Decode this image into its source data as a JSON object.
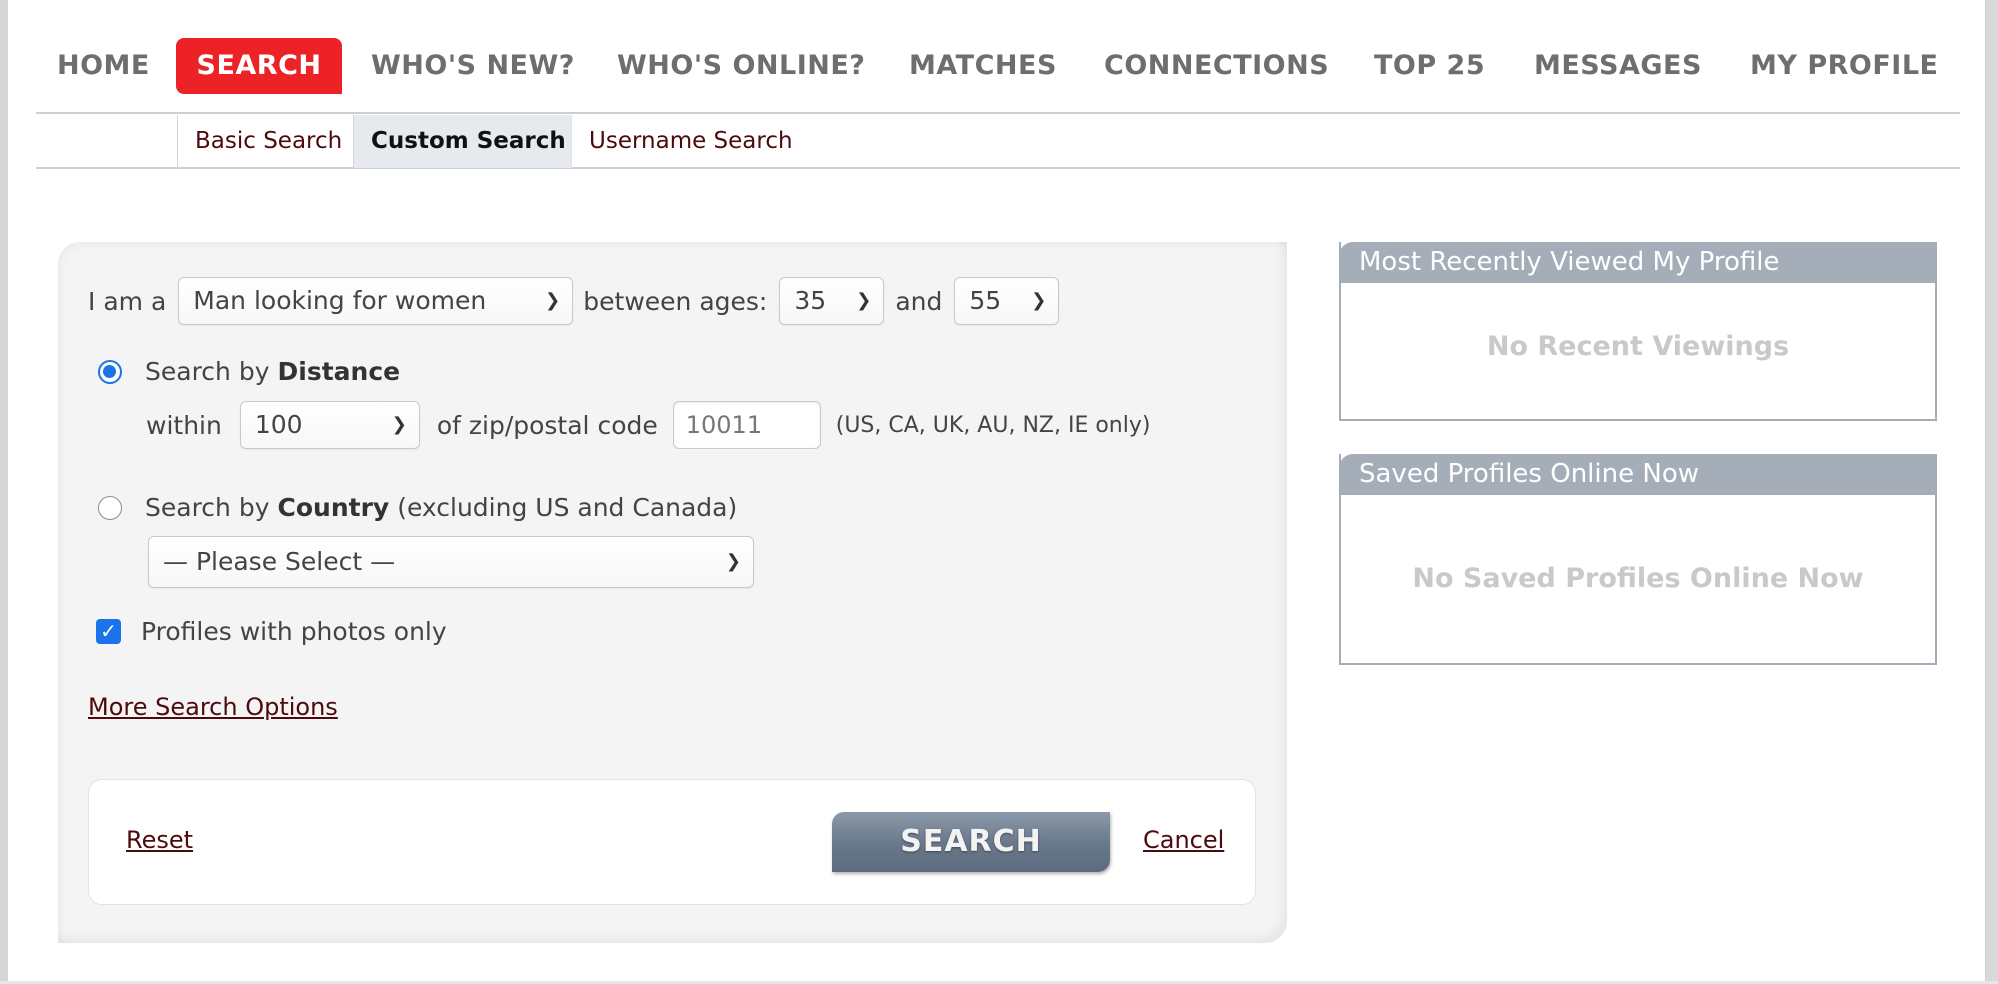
{
  "nav": {
    "items": [
      {
        "label": "HOME",
        "active": false
      },
      {
        "label": "SEARCH",
        "active": true
      },
      {
        "label": "WHO'S NEW?",
        "active": false
      },
      {
        "label": "WHO'S ONLINE?",
        "active": false
      },
      {
        "label": "MATCHES",
        "active": false
      },
      {
        "label": "CONNECTIONS",
        "active": false
      },
      {
        "label": "TOP 25",
        "active": false
      },
      {
        "label": "MESSAGES",
        "active": false
      },
      {
        "label": "MY PROFILE",
        "active": false
      }
    ]
  },
  "subtabs": {
    "items": [
      {
        "label": "Basic Search",
        "active": false
      },
      {
        "label": "Custom Search",
        "active": true
      },
      {
        "label": "Username Search",
        "active": false
      }
    ]
  },
  "form": {
    "i_am_a_label": "I am a",
    "seeking_value": "Man looking for women",
    "between_ages_label": "between ages:",
    "age_min": "35",
    "and_label": "and",
    "age_max": "55",
    "distance": {
      "label_prefix": "Search by",
      "label_bold": "Distance",
      "selected": true,
      "within_label": "within",
      "within_value": "100",
      "zip_label": "of zip/postal code",
      "zip_value": "10011",
      "zip_hint": "(US, CA, UK, AU, NZ, IE only)"
    },
    "country": {
      "label_prefix": "Search by",
      "label_bold": "Country",
      "label_suffix": "(excluding US and Canada)",
      "selected": false,
      "select_value": "— Please Select —"
    },
    "photos_only": {
      "label": "Profiles with photos only",
      "checked": true
    },
    "more_options_link": "More Search Options",
    "reset_link": "Reset",
    "search_button": "SEARCH",
    "cancel_link": "Cancel"
  },
  "sidebar": {
    "recent": {
      "title": "Most Recently Viewed My Profile",
      "empty": "No Recent Viewings"
    },
    "saved": {
      "title": "Saved Profiles Online Now",
      "empty": "No Saved Profiles Online Now"
    }
  },
  "colors": {
    "accent_red": "#ec2227",
    "link_maroon": "#4d0a0d",
    "sidebar_header": "#a5adb9",
    "control_blue": "#1a73e8"
  }
}
